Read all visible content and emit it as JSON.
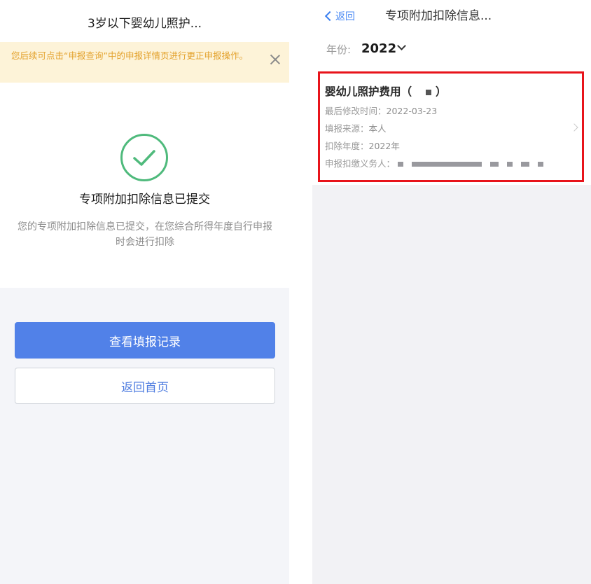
{
  "left": {
    "nav_title": "3岁以下婴幼儿照护...",
    "notice_text": "您后续可点击“申报查询”中的申报详情页进行更正申报操作。",
    "success_title": "专项附加扣除信息已提交",
    "success_desc": "您的专项附加扣除信息已提交，在您综合所得年度自行申报时会进行扣除",
    "primary_button": "查看填报记录",
    "secondary_button": "返回首页",
    "colors": {
      "accent": "#5181e8",
      "notice_bg": "#fdf3d8",
      "notice_text": "#e3a12b",
      "success": "#4fba7c"
    }
  },
  "right": {
    "back_label": "返回",
    "nav_title": "专项附加扣除信息...",
    "year_label": "年份:",
    "year_value": "2022",
    "card": {
      "title": "婴幼儿照护费用（",
      "title_close": "）",
      "modified_label": "最后修改时间：",
      "modified_value": "2022-03-23",
      "source_label": "填报来源：",
      "source_value": "本人",
      "year_label": "扣除年度：",
      "year_value": "2022年",
      "agent_label": "申报扣缴义务人："
    },
    "highlight_color": "#e8141b"
  }
}
